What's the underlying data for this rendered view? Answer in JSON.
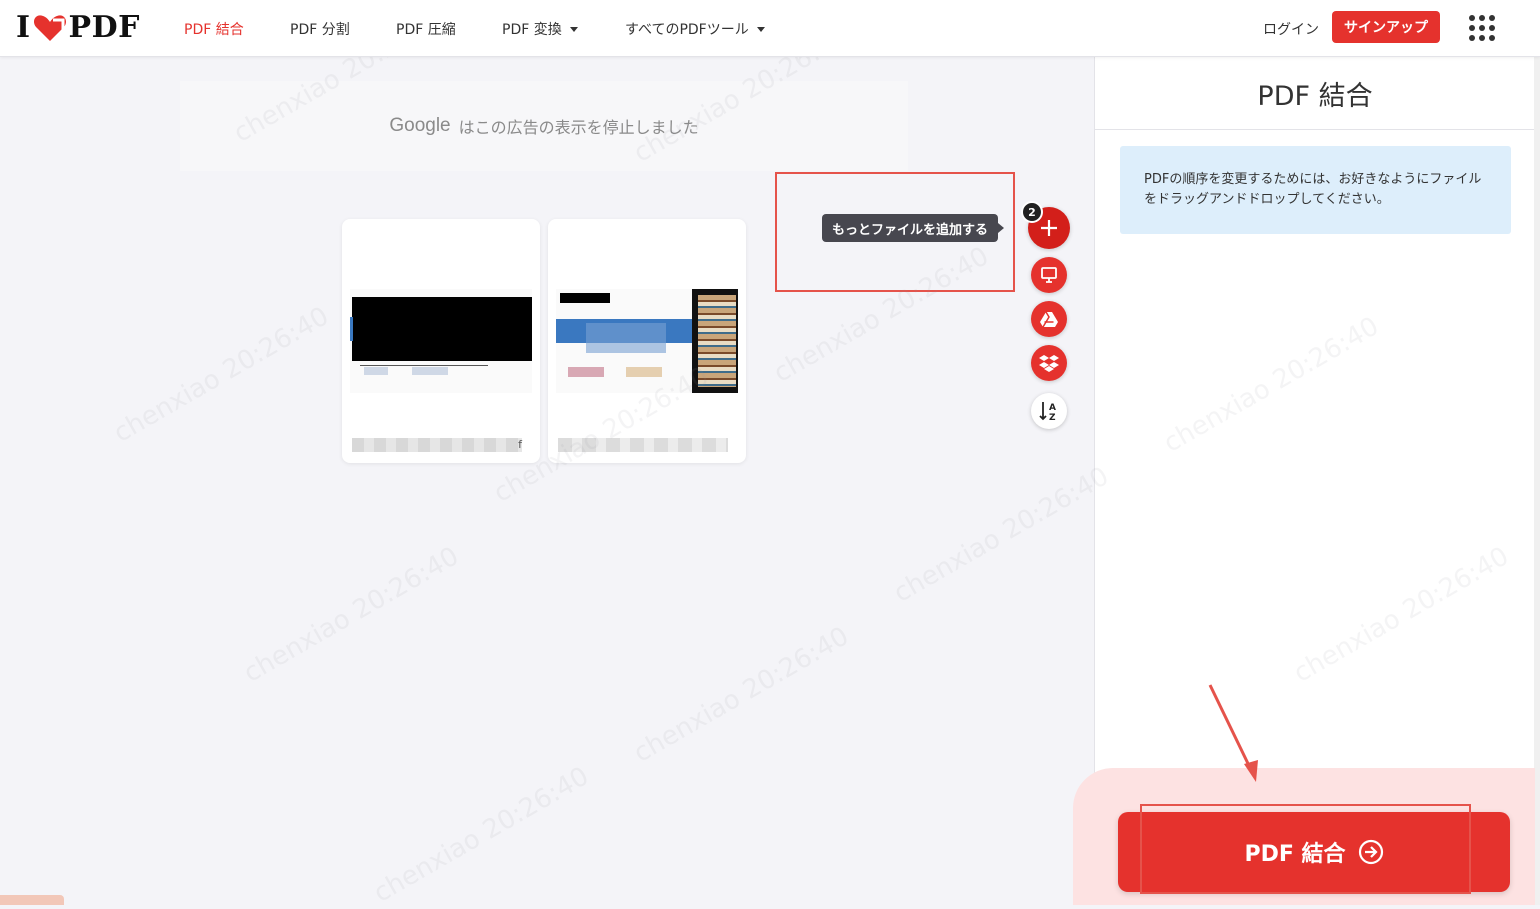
{
  "header": {
    "logo_text_left": "I",
    "logo_text_right": "PDF",
    "nav": [
      {
        "label": "PDF 結合",
        "active": true,
        "dropdown": false
      },
      {
        "label": "PDF 分割",
        "active": false,
        "dropdown": false
      },
      {
        "label": "PDF 圧縮",
        "active": false,
        "dropdown": false
      },
      {
        "label": "PDF 変換",
        "active": false,
        "dropdown": true
      },
      {
        "label": "すべてのPDFツール",
        "active": false,
        "dropdown": true
      }
    ],
    "login_label": "ログイン",
    "signup_label": "サインアップ",
    "apps_icon": "grid-icon"
  },
  "ad": {
    "google_label": "Google",
    "message": "はこの広告の表示を停止しました"
  },
  "files": {
    "count": "2",
    "cards": [
      {
        "name_suffix": "f"
      },
      {
        "name_suffix": ""
      }
    ]
  },
  "actions": {
    "tooltip": "もっとファイルを追加する",
    "buttons": [
      "add-file-icon",
      "computer-icon",
      "google-drive-icon",
      "dropbox-icon",
      "sort-az-icon"
    ]
  },
  "sidebar": {
    "title": "PDF 結合",
    "info": "PDFの順序を変更するためには、お好きなようにファイルをドラッグアンドドロップしてください。",
    "merge_button": "PDF 結合"
  },
  "watermark": {
    "user": "chenxiao",
    "time": "20:26:40"
  },
  "colors": {
    "brand_red": "#e5322d",
    "info_bg": "#ddeefb",
    "annotation_red": "#e5534b"
  }
}
